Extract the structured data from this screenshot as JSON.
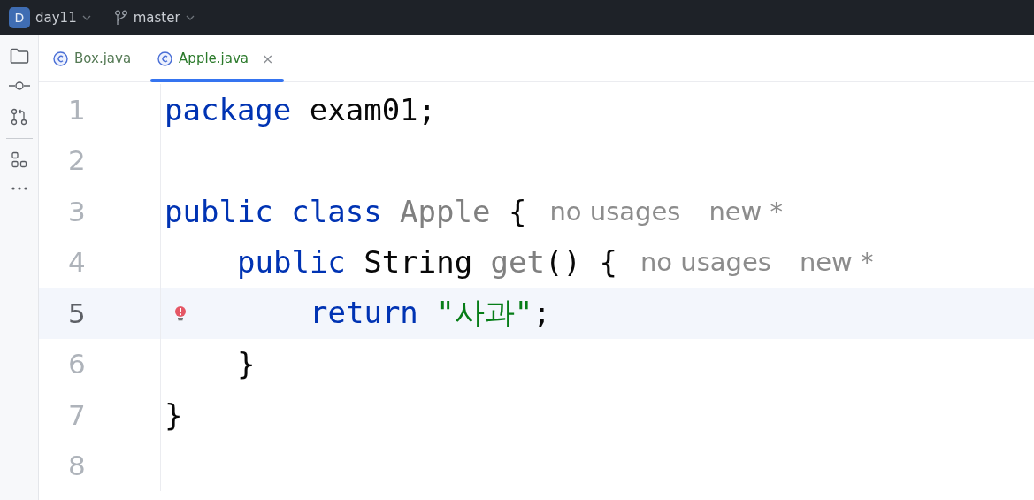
{
  "title_bar": {
    "project": {
      "badge": "D",
      "name": "day11"
    },
    "branch": "master"
  },
  "tabs": [
    {
      "label": "Box.java",
      "selected": false,
      "closable": false
    },
    {
      "label": "Apple.java",
      "selected": true,
      "closable": true,
      "close_glyph": "×"
    }
  ],
  "editor": {
    "lines": [
      {
        "number": "1",
        "current": false,
        "error": false,
        "tokens": [
          {
            "kind": "keyword",
            "text": "package"
          },
          {
            "kind": "plain",
            "text": " exam01;"
          }
        ]
      },
      {
        "number": "2",
        "current": false,
        "error": false
      },
      {
        "number": "3",
        "current": false,
        "error": false,
        "tokens": [
          {
            "kind": "keyword",
            "text": "public class"
          },
          {
            "kind": "unused",
            "text": " Apple"
          },
          {
            "kind": "plain",
            "text": " {"
          }
        ],
        "hints": [
          "no usages",
          "new *"
        ],
        "children": [
          {
            "number": "4",
            "current": false,
            "error": false,
            "tokens": [
              {
                "kind": "keyword",
                "text": "public"
              },
              {
                "kind": "plain",
                "text": " String "
              },
              {
                "kind": "unused",
                "text": "get"
              },
              {
                "kind": "plain",
                "text": "() {"
              }
            ],
            "hints": [
              "no usages",
              "new *"
            ],
            "children": [
              {
                "number": "5",
                "current": true,
                "error": true,
                "tokens": [
                  {
                    "kind": "keyword",
                    "text": "return"
                  },
                  {
                    "kind": "string",
                    "text": " \"사과\""
                  },
                  {
                    "kind": "plain",
                    "text": ";"
                  }
                ]
              }
            ]
          },
          {
            "number": "6",
            "current": false,
            "error": false,
            "tokens": [
              {
                "kind": "plain",
                "text": "}"
              }
            ]
          }
        ]
      },
      {
        "number": "7",
        "current": false,
        "error": false,
        "tokens": [
          {
            "kind": "plain",
            "text": "}"
          }
        ]
      },
      {
        "number": "8",
        "current": false,
        "error": false
      }
    ]
  }
}
